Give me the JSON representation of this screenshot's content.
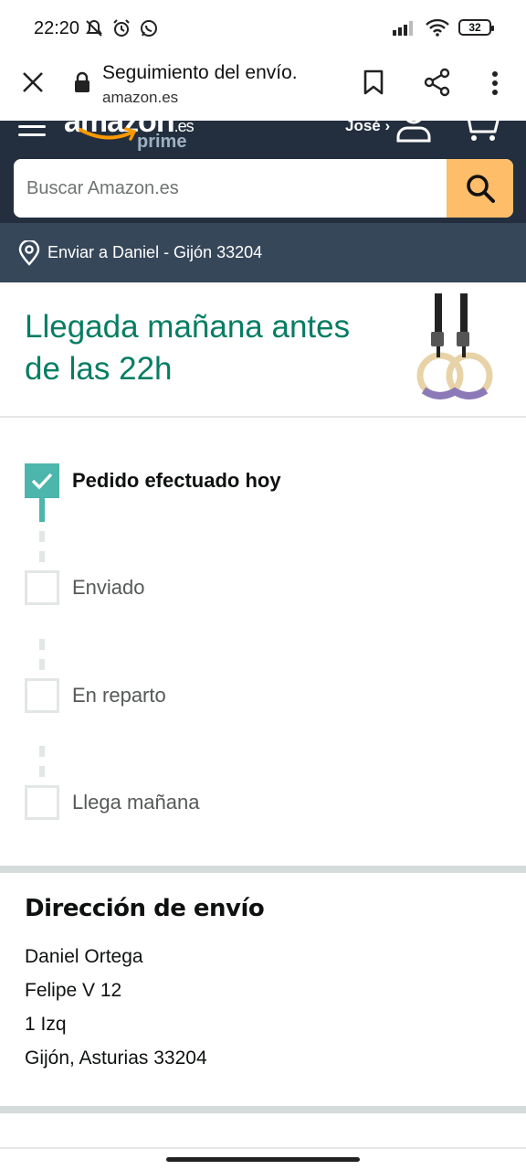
{
  "status_bar": {
    "time": "22:20",
    "battery": "32",
    "left_icons": [
      "mute-notifications-icon",
      "alarm-icon",
      "whatsapp-icon"
    ],
    "right_icons": [
      "signal-icon",
      "wifi-icon",
      "battery-icon"
    ]
  },
  "browser": {
    "title": "Seguimiento del envío.",
    "url": "amazon.es"
  },
  "header": {
    "logo_text": "amazon",
    "logo_suffix": ".es",
    "prime_text": "prime",
    "user_name": "José ›"
  },
  "search": {
    "placeholder": "Buscar Amazon.es"
  },
  "deliver": {
    "text": "Enviar a Daniel - Gijón 33204"
  },
  "arrival": {
    "title": "Llegada mañana antes de las 22h"
  },
  "tracking": {
    "steps": [
      {
        "label": "Pedido efectuado hoy",
        "done": true
      },
      {
        "label": "Enviado",
        "done": false
      },
      {
        "label": "En reparto",
        "done": false
      },
      {
        "label": "Llega mañana",
        "done": false
      }
    ]
  },
  "shipping_address": {
    "heading": "Dirección de envío",
    "lines": [
      "Daniel Ortega",
      "Felipe V 12",
      "1 Izq",
      "Gijón, Asturias 33204"
    ]
  },
  "colors": {
    "header_bg": "#232f3e",
    "deliver_bg": "#37475a",
    "accent_teal": "#067d62",
    "step_done": "#4db6ac",
    "search_button": "#febd69"
  }
}
